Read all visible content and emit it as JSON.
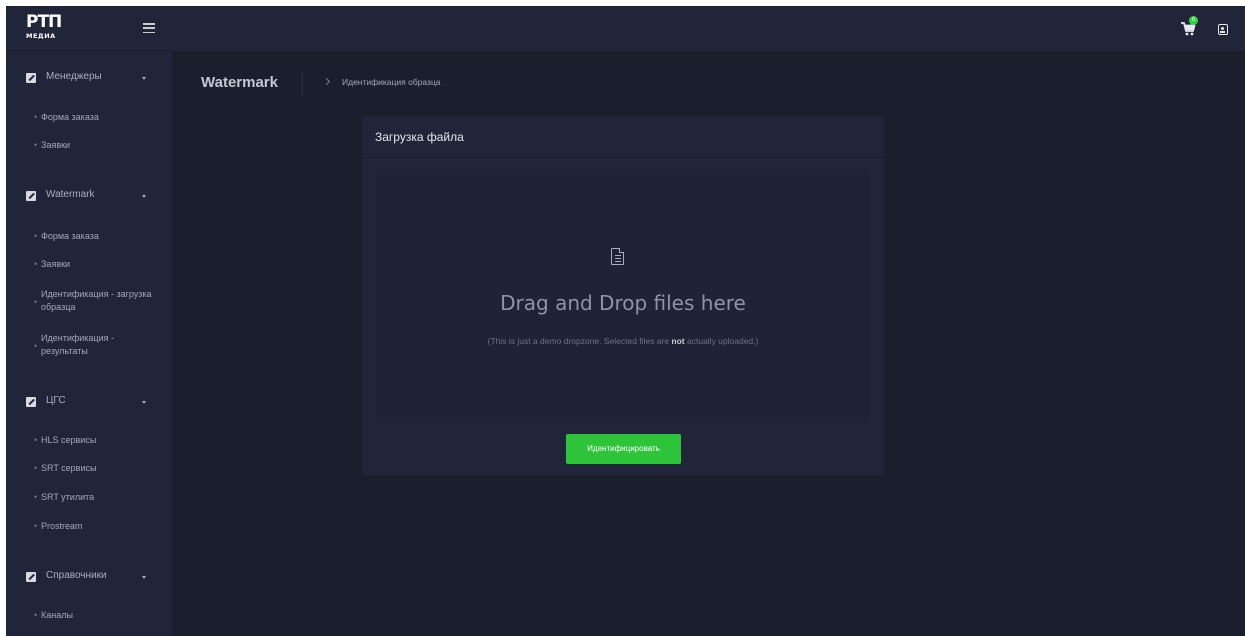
{
  "brand": {
    "logo_text": "РТП",
    "logo_sub": "МЕДИА"
  },
  "topbar": {
    "cart_count": "0"
  },
  "sidebar": {
    "sections": [
      {
        "label": "Менеджеры",
        "items": [
          "Форма заказа",
          "Заявки"
        ]
      },
      {
        "label": "Watermark",
        "items": [
          "Форма заказа",
          "Заявки",
          "Идентификация - загрузка образца",
          "Идентификация - результаты"
        ]
      },
      {
        "label": "ЦГС",
        "items": [
          "HLS сервисы",
          "SRT сервисы",
          "SRT утилита",
          "Prostream"
        ]
      },
      {
        "label": "Справочники",
        "items": [
          "Каналы"
        ]
      }
    ]
  },
  "page": {
    "title": "Watermark",
    "breadcrumb": "Идентификация образца"
  },
  "card": {
    "title": "Загрузка файла",
    "dropzone_title": "Drag and Drop files here",
    "dropzone_note_before": "(This is just a demo dropzone. Selected files are ",
    "dropzone_note_bold": "not",
    "dropzone_note_after": " actually uploaded.)",
    "button_label": "Идентифицировать"
  },
  "colors": {
    "accent_green": "#2ec43a",
    "background": "#1b1f2d",
    "panel": "#20253a"
  }
}
